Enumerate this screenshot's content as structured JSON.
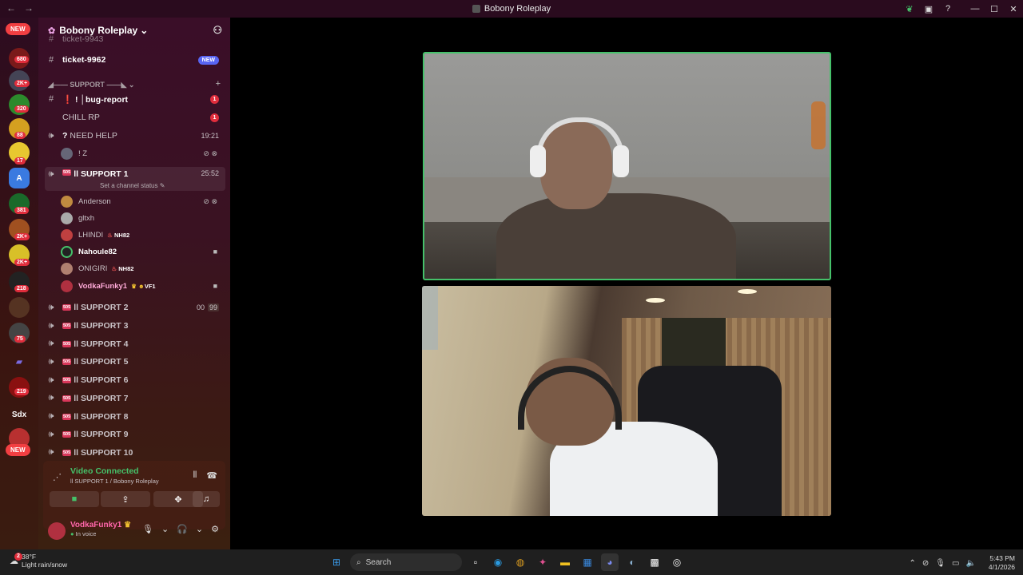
{
  "window": {
    "title": "Bobony Roleplay",
    "back_icon": "←",
    "forward_icon": "→"
  },
  "server_rail": {
    "new_top": "NEW",
    "new_bottom": "NEW",
    "badges": [
      "680",
      "2K+",
      "320",
      "88",
      "17",
      "381",
      "2K+",
      "2K+",
      "218",
      "75",
      "219"
    ],
    "sdx_label": "Sdx",
    "a_label": "A"
  },
  "guild": {
    "name": "Bobony Roleplay",
    "chevron": "⌄"
  },
  "channels": {
    "partial_top": "ticket-9943",
    "ticket": {
      "name": "ticket-9962",
      "badge": "NEW"
    },
    "category_support": "SUPPORT",
    "bug_report": {
      "name": "! │bug-report",
      "badge": "1"
    },
    "chill_rp": {
      "name": "CHILL RP",
      "badge": "1"
    },
    "need_help": {
      "name": "NEED HELP",
      "time": "19:21",
      "prefix": "?"
    },
    "need_help_user": "! Z",
    "support1": {
      "name": "SUPPORT 1",
      "time": "25:52",
      "status": "Set a channel status"
    },
    "support2": {
      "name": "SUPPORT 2",
      "count_a": "00",
      "count_b": "99"
    },
    "others": [
      "SUPPORT 3",
      "SUPPORT 4",
      "SUPPORT 5",
      "SUPPORT 6",
      "SUPPORT 7",
      "SUPPORT 8",
      "SUPPORT 9",
      "SUPPORT 10"
    ],
    "tag": "505"
  },
  "voice_users": [
    {
      "name": "Anderson",
      "extra": ""
    },
    {
      "name": "gltxh",
      "extra": ""
    },
    {
      "name": "LHINDI",
      "extra": "NH82"
    },
    {
      "name": "Nahoule82",
      "extra": ""
    },
    {
      "name": "ONIGIRI",
      "extra": "NH82"
    },
    {
      "name": "VodkaFunky1",
      "extra": "VF1"
    }
  ],
  "voice_panel": {
    "status": "Video Connected",
    "location": "ll SUPPORT 1 / Bobony Roleplay"
  },
  "user_bar": {
    "name": "VodkaFunky1",
    "status": "In voice"
  },
  "taskbar": {
    "weather_temp": "38°F",
    "weather_desc": "Light rain/snow",
    "weather_badge": "2",
    "search_placeholder": "Search",
    "time": "5:43 PM",
    "date": "4/1/2026"
  },
  "colors": {
    "accent_green": "#45c16a",
    "badge_red": "#e02d3c",
    "new_blue": "#5865f2"
  }
}
